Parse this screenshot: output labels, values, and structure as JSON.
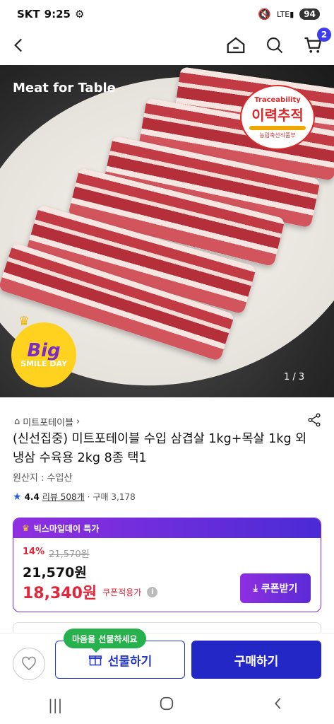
{
  "status": {
    "carrier": "SKT",
    "time": "9:25",
    "battery": "94"
  },
  "header": {
    "cart_count": "2"
  },
  "hero": {
    "brand": "Meat for Table",
    "trace_en": "Traceability",
    "trace_ko": "이력추적",
    "trace_agency": "농림축산식품부",
    "big": "Big",
    "smile_day": "SMILE DAY",
    "pager": "1 / 3"
  },
  "product": {
    "seller": "미트포테이블",
    "title": "(신선집중) 미트포테이블 수입 삼겹살 1kg+목살 1kg 외 냉삼 수육용 2kg 8종 택1",
    "origin": "원산지 : 수입산",
    "rating": "4.4",
    "reviews": "리뷰 508개",
    "purchases": "구매 3,178"
  },
  "deal": {
    "title": "빅스마일데이 특가",
    "discount": "14%",
    "original_price": "21,570원",
    "price": "21,570원",
    "coupon_price": "18,340원",
    "coupon_label": "쿠폰적용가",
    "coupon_button": "쿠폰받기"
  },
  "bottom": {
    "tooltip": "마음을 선물하세요",
    "gift": "선물하기",
    "buy": "구매하기"
  }
}
